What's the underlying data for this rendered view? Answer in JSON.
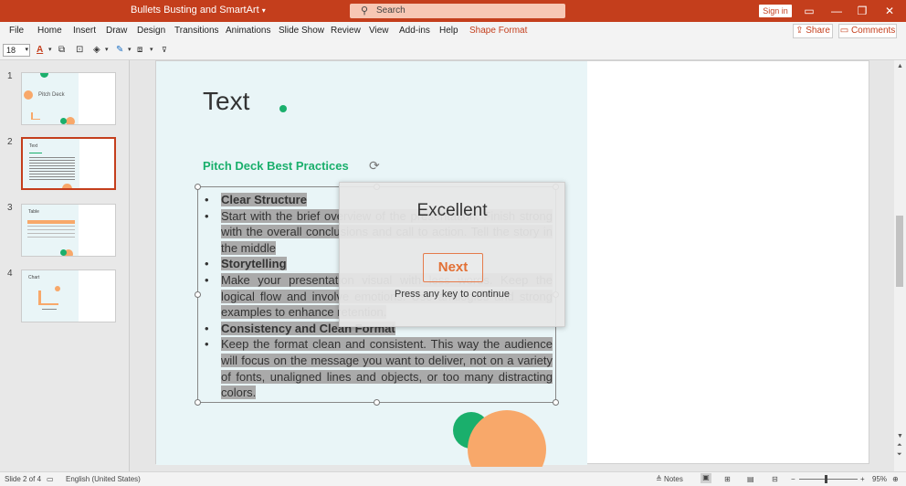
{
  "titlebar": {
    "title": "Bullets Busting and SmartArt",
    "title_chevron": "▾",
    "search_placeholder": "Search",
    "signin": "Sign in",
    "ribbon_display": "▭",
    "minimize": "—",
    "restore": "❐",
    "close": "✕"
  },
  "menu": {
    "items": [
      "File",
      "Home",
      "Insert",
      "Draw",
      "Design",
      "Transitions",
      "Animations",
      "Slide Show",
      "Review",
      "View",
      "Add-ins",
      "Help",
      "Shape Format"
    ],
    "share": "Share",
    "comments": "Comments"
  },
  "toolbar": {
    "font_size": "18",
    "font_color_label": "A"
  },
  "thumbnails": {
    "numbers": [
      "1",
      "2",
      "3",
      "4"
    ],
    "titles": [
      "Pitch Deck",
      "Text",
      "Table",
      "Chart"
    ]
  },
  "slide": {
    "title": "Text",
    "heading": "Pitch Deck Best Practices",
    "bullets": [
      {
        "text": "Clear Structure",
        "bold": true
      },
      {
        "text": "Start with the brief overview of the presentation. Finish strong with the overall conclusions and call to action. Tell the story in the middle",
        "bold": false
      },
      {
        "text": "Storytelling",
        "bold": true
      },
      {
        "text": "Make your presentation visual with less words. Keep the logical flow and involve emotions. Use analogies and strong examples to enhance retention.",
        "bold": false
      },
      {
        "text": "Consistency and Clean Format",
        "bold": true
      },
      {
        "text": "Keep the format clean and consistent. This way the audience will focus on the message you want to deliver, not on a variety of fonts, unaligned lines and objects, or too many distracting colors.",
        "bold": false
      }
    ]
  },
  "dialog": {
    "title": "Excellent",
    "button": "Next",
    "hint": "Press any key to continue"
  },
  "status": {
    "slide": "Slide 2 of 4",
    "language": "English (United States)",
    "notes": "Notes",
    "zoom": "95%"
  },
  "colors": {
    "accent": "#c43e1c",
    "green": "#1aaf6c",
    "orange": "#f8a86a"
  }
}
